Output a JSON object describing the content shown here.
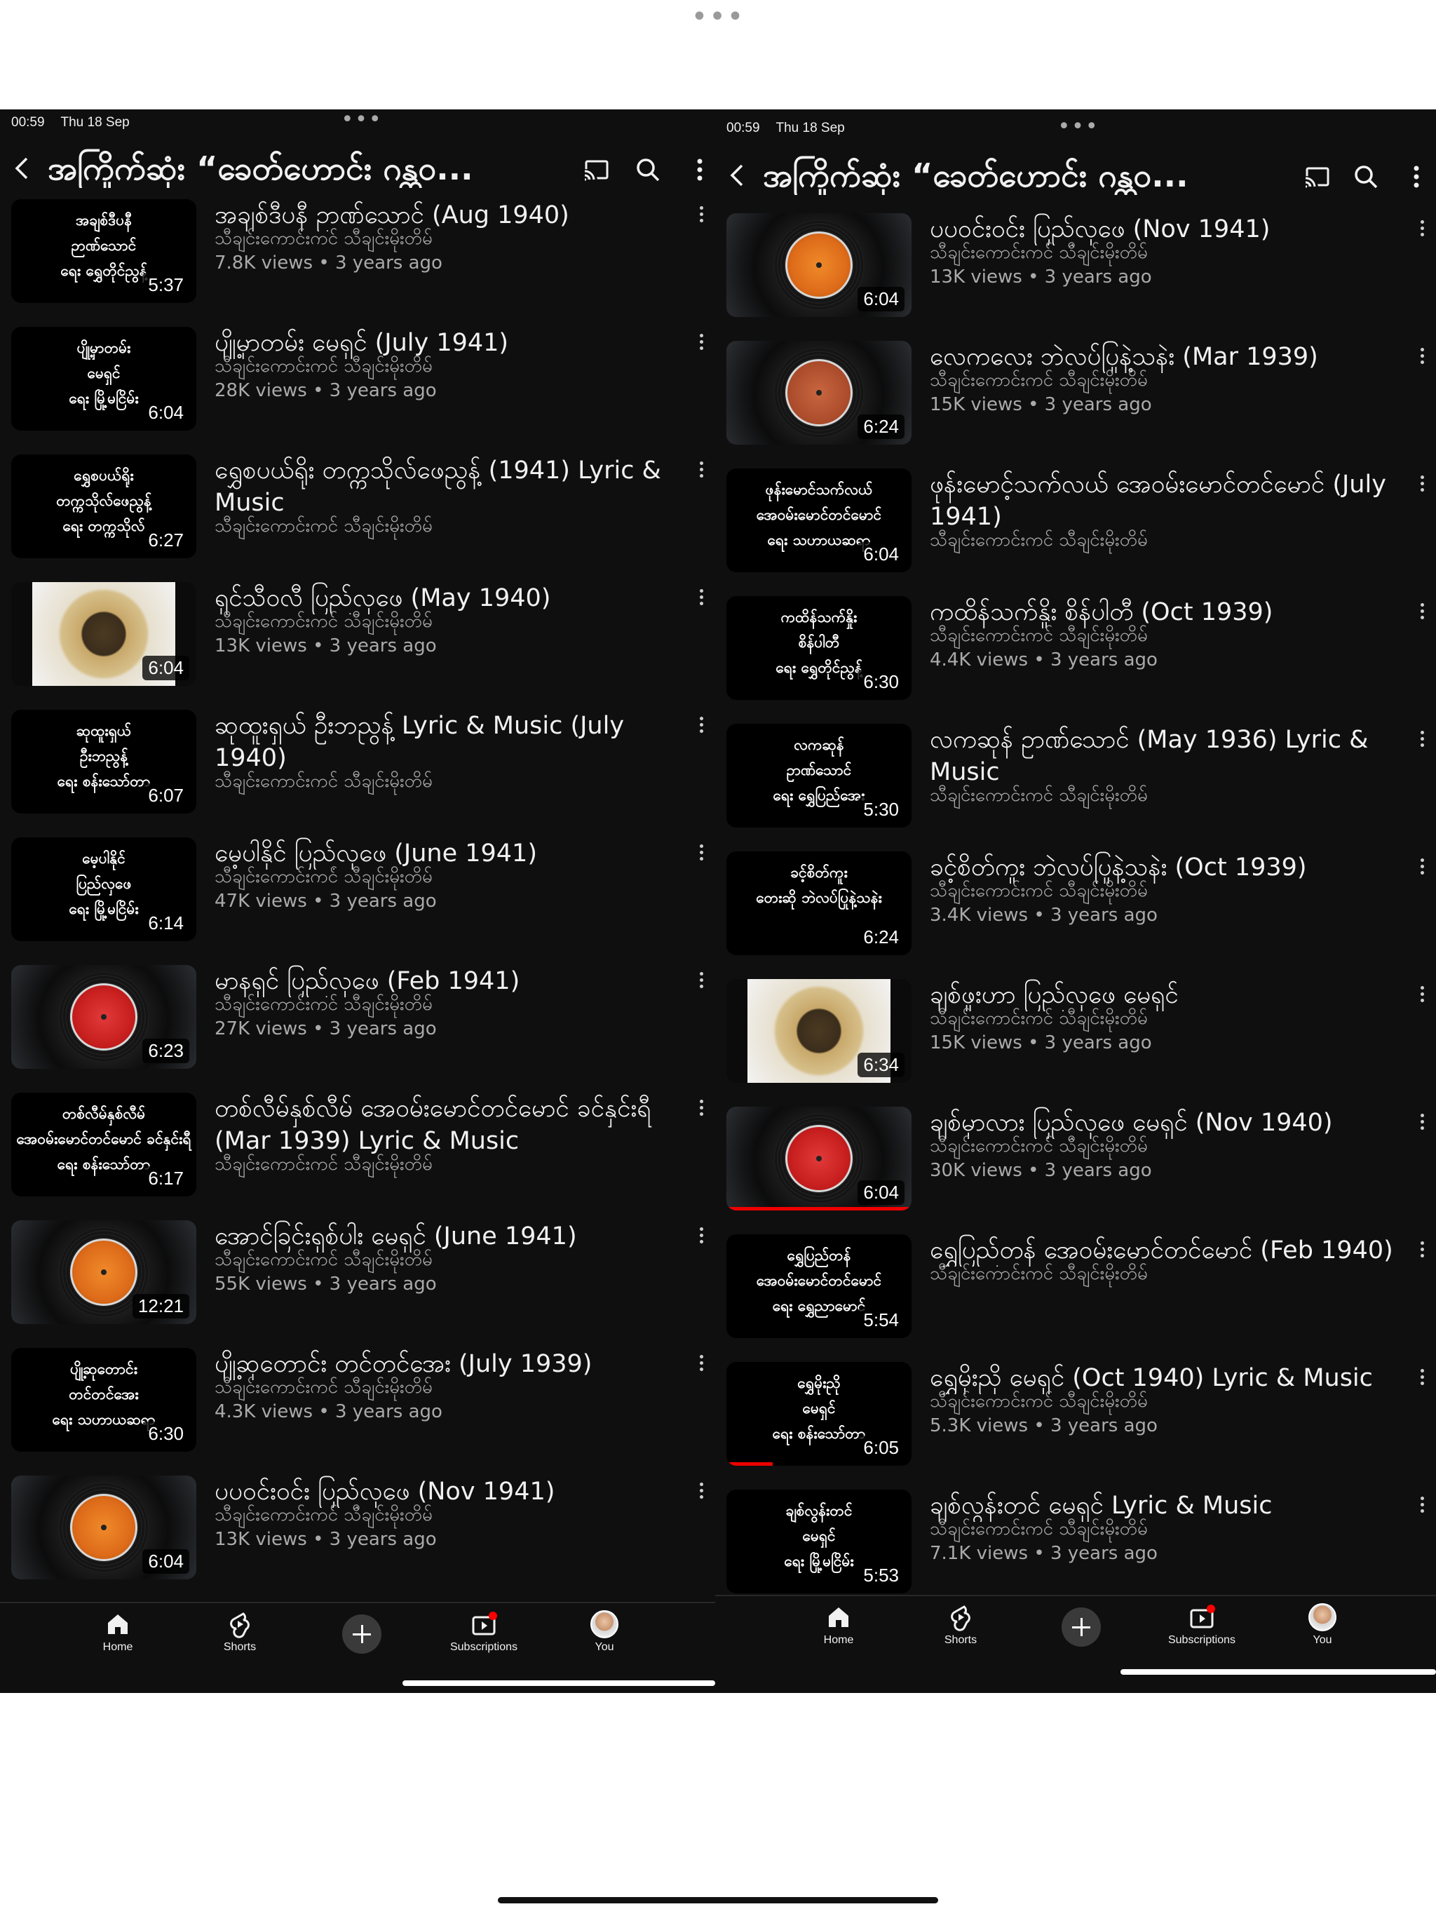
{
  "status": {
    "time": "00:59",
    "date": "Thu 18 Sep"
  },
  "header": {
    "title": "အကြိုက်ဆုံး “ခေတ်ဟောင်း ဂန္ထဝ..."
  },
  "nav": {
    "home": "Home",
    "shorts": "Shorts",
    "subscriptions": "Subscriptions",
    "you": "You"
  },
  "colors": {
    "background": "#0f0f0f",
    "text": "#f1f1f1",
    "secondary": "#aaaaaa",
    "accent": "#ff0000"
  },
  "left_videos": [
    {
      "thumb_text": "အချစ်ဒီပနီ\nဉာဏ်သောင်\nရေး ရွှေတိုင်ညွန့်",
      "thumb_style": "text",
      "duration": "5:37",
      "title": "အချစ်ဒီပနီ ဥာဏ်သောင် (Aug 1940)",
      "channel": "သီချင်းကောင်းကင် သီချင်းမိုးတိမ်",
      "meta": "7.8K views • 3 years ago"
    },
    {
      "thumb_text": "ပျို့မှာတမ်း\nမေရှင်\nရေး မြို့မငြိမ်း",
      "thumb_style": "text",
      "duration": "6:04",
      "title": "ပျို့မှာတမ်း မေရှင် (July 1941)",
      "channel": "သီချင်းကောင်းကင် သီချင်းမိုးတိမ်",
      "meta": "28K views • 3 years ago"
    },
    {
      "thumb_text": "ရွှေစပယ်ရိုး\nတက္ကသိုလ်ဖေညွန့်\nရေး တက္ကသိုလ်",
      "thumb_style": "text",
      "duration": "6:27",
      "title": "ရွှေစပယ်ရိုး တက္ကသိုလ်ဖေညွန့် (1941) Lyric & Music",
      "channel": "သီချင်းကောင်းကင် သီချင်းမိုးတိမ်",
      "meta": ""
    },
    {
      "thumb_text": "",
      "thumb_style": "photo",
      "duration": "6:04",
      "title": "ရှင်သီဝလီ ပြည်လှဖေ (May 1940)",
      "channel": "သီချင်းကောင်းကင် သီချင်းမိုးတိမ်",
      "meta": "13K views • 3 years ago"
    },
    {
      "thumb_text": "ဆုထူးရှယ်\nဦးဘညွန့်\nရေး စန်းသော်တာ",
      "thumb_style": "text",
      "duration": "6:07",
      "title": "ဆုထူးရှယ် ဦးဘညွန့် Lyric & Music (July 1940)",
      "channel": "သီချင်းကောင်းကင် သီချင်းမိုးတိမ်",
      "meta": ""
    },
    {
      "thumb_text": "မေ့ပါနိုင်\nပြည်လှဖေ\nရေး မြို့မငြိမ်း",
      "thumb_style": "text",
      "duration": "6:14",
      "title": "မေ့ပါနိုင် ပြည်လှဖေ (June 1941)",
      "channel": "သီချင်းကောင်းကင် သီချင်းမိုးတိမ်",
      "meta": "47K views • 3 years ago"
    },
    {
      "thumb_text": "",
      "thumb_style": "vinyl-red",
      "duration": "6:23",
      "title": "မာနရှင် ပြည်လှဖေ (Feb 1941)",
      "channel": "သီချင်းကောင်းကင် သီချင်းမိုးတိမ်",
      "meta": "27K views • 3 years ago"
    },
    {
      "thumb_text": "တစ်လီမ်နှစ်လီမ်\nအေဝမ်းမောင်တင်မောင် ခင်နှင်းရီ\nရေး စန်းသော်တာ",
      "thumb_style": "text",
      "duration": "6:17",
      "title": "တစ်လီမ်နှစ်လီမ် အေဝမ်းမောင်တင်မောင် ခင်နှင်းရီ (Mar 1939) Lyric & Music",
      "channel": "သီချင်းကောင်းကင် သီချင်းမိုးတိမ်",
      "meta": ""
    },
    {
      "thumb_text": "",
      "thumb_style": "vinyl-orange",
      "duration": "12:21",
      "title": "အောင်ခြင်းရှစ်ပါး မေရှင် (June 1941)",
      "channel": "သီချင်းကောင်းကင် သီချင်းမိုးတိမ်",
      "meta": "55K views • 3 years ago"
    },
    {
      "thumb_text": "ပျို့ဆုတောင်း\nတင်တင်အေး\nရေး သဟာယဆရာ",
      "thumb_style": "text",
      "duration": "6:30",
      "title": "ပျို့ဆုတောင်း တင်တင်အေး (July 1939)",
      "channel": "သီချင်းကောင်းကင် သီချင်းမိုးတိမ်",
      "meta": "4.3K views • 3 years ago"
    },
    {
      "thumb_text": "",
      "thumb_style": "vinyl-orange",
      "duration": "6:04",
      "title": "ပပဝင်းဝင်း ပြည်လှဖေ (Nov 1941)",
      "channel": "သီချင်းကောင်းကင် သီချင်းမိုးတိမ်",
      "meta": "13K views • 3 years ago"
    }
  ],
  "right_videos": [
    {
      "thumb_text": "",
      "thumb_style": "vinyl-orange",
      "duration": "6:04",
      "title": "ပပဝင်းဝင်း ပြည်လှဖေ (Nov 1941)",
      "channel": "သီချင်းကောင်းကင် သီချင်းမိုးတိမ်",
      "meta": "13K views • 3 years ago"
    },
    {
      "thumb_text": "",
      "thumb_style": "vinyl-columbia",
      "duration": "6:24",
      "title": "လေကလေး ဘဲလပ်ပြုနဲ့သနဲး (Mar 1939)",
      "channel": "သီချင်းကောင်းကင် သီချင်းမိုးတိမ်",
      "meta": "15K views • 3 years ago"
    },
    {
      "thumb_text": "ဖုန်းမောင်သက်လယ်\nအေဝမ်းမောင်တင်မောင်\nရေး သဟာယဆရာ",
      "thumb_style": "text",
      "duration": "6:04",
      "title": "ဖုန်းမောင့်သက်လယ် အေဝမ်းမောင်တင်မောင် (July 1941)",
      "channel": "သီချင်းကောင်းကင် သီချင်းမိုးတိမ်",
      "meta": ""
    },
    {
      "thumb_text": "ကထိန်သက်နှိုး\nစိန်ပါတီ\nရေး ရွှေတိုင်ညွန့်",
      "thumb_style": "text",
      "duration": "6:30",
      "title": "ကထိန်သက်နှိုး စိန်ပါတီ (Oct 1939)",
      "channel": "သီချင်းကောင်းကင် သီချင်းမိုးတိမ်",
      "meta": "4.4K views • 3 years ago"
    },
    {
      "thumb_text": "လကဆုန်\nဥာဏ်သောင်\nရေး ရွှေပြည်အေး",
      "thumb_style": "text",
      "duration": "5:30",
      "title": "လကဆုန် ဥာဏ်သောင် (May 1936) Lyric & Music",
      "channel": "သီချင်းကောင်းကင် သီချင်းမိုးတိမ်",
      "meta": ""
    },
    {
      "thumb_text": "ခင့်စိတ်ကူး\nတေးဆို ဘဲလပ်ပြုနဲ့သနဲး",
      "thumb_style": "text",
      "duration": "6:24",
      "title": "ခင့်စိတ်ကူး ဘဲလပ်ပြုနဲ့သနဲး (Oct 1939)",
      "channel": "သီချင်းကောင်းကင် သီချင်းမိုးတိမ်",
      "meta": "3.4K views • 3 years ago"
    },
    {
      "thumb_text": "",
      "thumb_style": "photo",
      "duration": "6:34",
      "title": "ချစ်ဖူးဟာ ပြည်လှဖေ မေရှင်",
      "channel": "သီချင်းကောင်းကင် သီချင်းမိုးတိမ်",
      "meta": "15K views • 3 years ago"
    },
    {
      "thumb_text": "",
      "thumb_style": "vinyl-red",
      "duration": "6:04",
      "title": "ချစ်မှာလား ပြည်လှဖေ မေရှင် (Nov 1940)",
      "channel": "သီချင်းကောင်းကင် သီချင်းမိုးတိမ်",
      "meta": "30K views • 3 years ago",
      "watched": 1.0
    },
    {
      "thumb_text": "ရွှေပြည်တန်\nအေဝမ်းမောင်တင်မောင်\nရေး ရွှေညာမောင်",
      "thumb_style": "text",
      "duration": "5:54",
      "title": "ရွှေပြည်တန် အေဝမ်းမောင်တင်မောင် (Feb 1940)",
      "channel": "သီချင်းကောင်းကင် သီချင်းမိုးတိမ်",
      "meta": ""
    },
    {
      "thumb_text": "ရွှေမိုးညို\nမေရှင်\nရေး စန်းသော်တာ",
      "thumb_style": "text",
      "duration": "6:05",
      "title": "ရွှေမိုးညို မေရှင် (Oct 1940) Lyric & Music",
      "channel": "သီချင်းကောင်းကင် သီချင်းမိုးတိမ်",
      "meta": "5.3K views • 3 years ago",
      "watched": 0.25
    },
    {
      "thumb_text": "ချစ်လွန်းတင်\nမေရှင်\nရေး မြို့မငြိမ်း",
      "thumb_style": "text",
      "duration": "5:53",
      "title": "ချစ်လွန်းတင် မေရှင် Lyric & Music",
      "channel": "သီချင်းကောင်းကင် သီချင်းမိုးတိမ်",
      "meta": "7.1K views • 3 years ago"
    }
  ]
}
